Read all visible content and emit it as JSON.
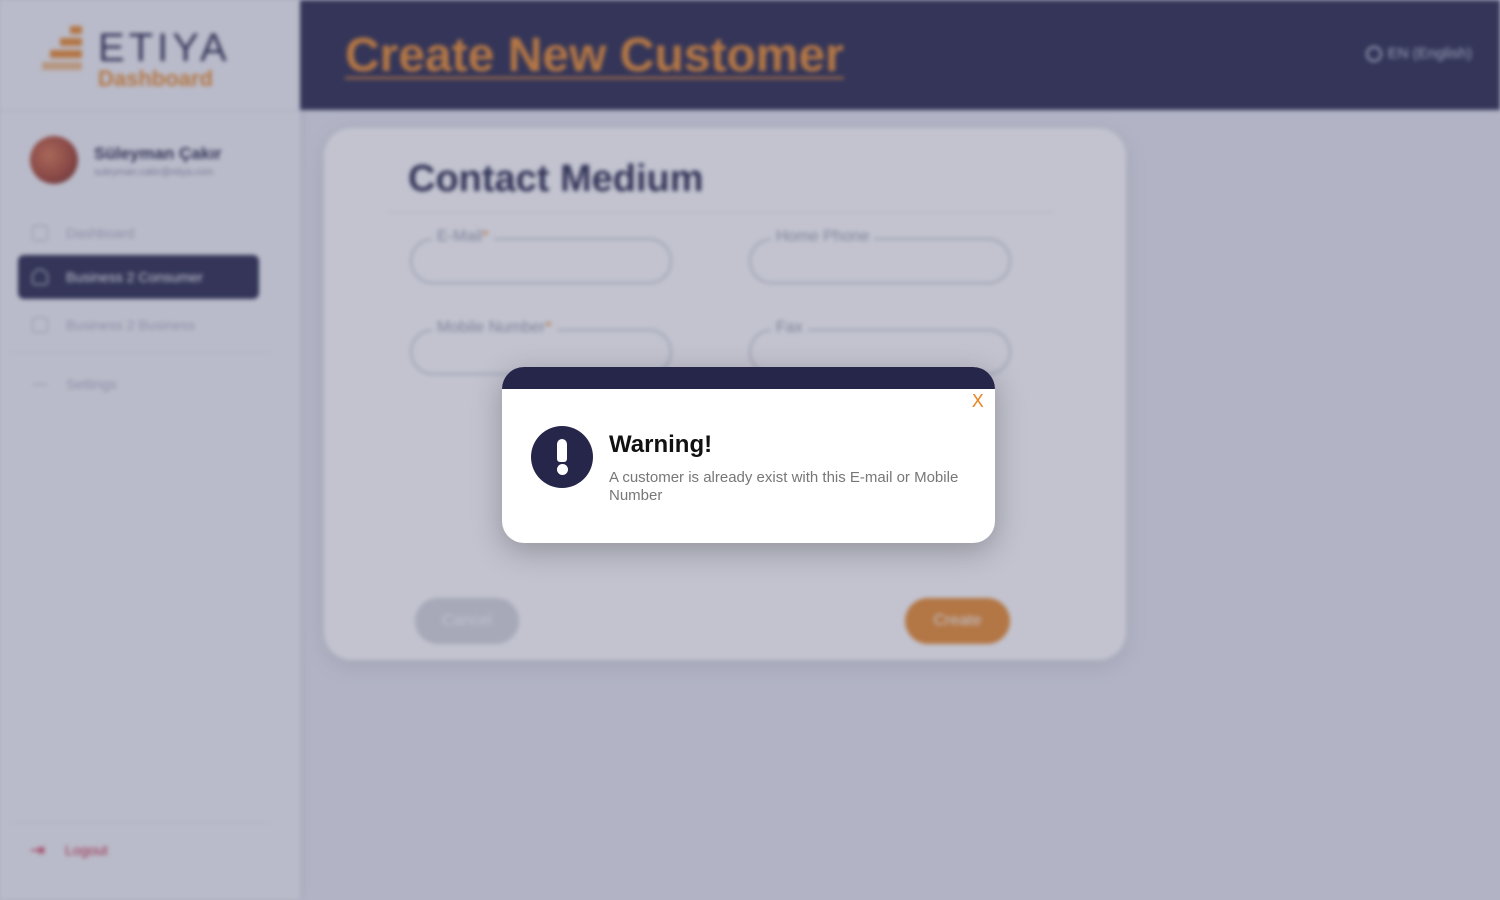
{
  "app": {
    "logo_text": "ETIYA",
    "logo_sub": "Dashboard"
  },
  "header": {
    "title": "Create New Customer",
    "language": "EN (English)"
  },
  "user": {
    "name": "Süleyman Çakır",
    "email": "suleyman.cakir@etiya.com"
  },
  "sidebar": {
    "items": [
      {
        "label": "Dashboard",
        "icon": "grid-icon"
      },
      {
        "label": "Business 2 Consumer",
        "icon": "user-icon",
        "active": true
      },
      {
        "label": "Business 2 Business",
        "icon": "calendar-icon"
      },
      {
        "label": "Settings",
        "icon": "settings-icon"
      }
    ],
    "logout": "Logout"
  },
  "form": {
    "section_title": "Contact Medium",
    "fields": {
      "email": {
        "label": "E-Mail",
        "required": "*",
        "value": ""
      },
      "home_phone": {
        "label": "Home Phone",
        "value": ""
      },
      "mobile": {
        "label": "Mobile Number",
        "required": "*",
        "value": ""
      },
      "fax": {
        "label": "Fax",
        "value": ""
      }
    },
    "cancel_label": "Cancel",
    "create_label": "Create"
  },
  "modal": {
    "close_label": "X",
    "title": "Warning!",
    "message": "A customer is already exist with this E-mail or Mobile Number"
  },
  "colors": {
    "navy": "#25264a",
    "accent_orange": "#e98a2c",
    "logout_red": "#c81d3a"
  }
}
